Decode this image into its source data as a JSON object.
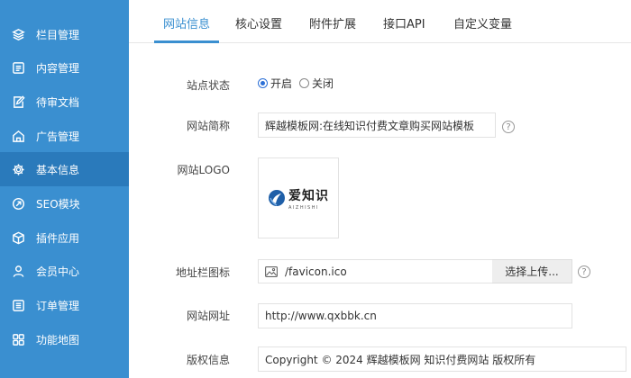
{
  "sidebar": {
    "items": [
      {
        "label": "栏目管理",
        "icon": "layers-icon"
      },
      {
        "label": "内容管理",
        "icon": "list-box-icon"
      },
      {
        "label": "待审文档",
        "icon": "edit-doc-icon"
      },
      {
        "label": "广告管理",
        "icon": "house-icon"
      },
      {
        "label": "基本信息",
        "icon": "gear-icon"
      },
      {
        "label": "SEO模块",
        "icon": "link-circle-icon"
      },
      {
        "label": "插件应用",
        "icon": "cube-icon"
      },
      {
        "label": "会员中心",
        "icon": "user-icon"
      },
      {
        "label": "订单管理",
        "icon": "order-list-icon"
      },
      {
        "label": "功能地图",
        "icon": "grid-icon"
      }
    ],
    "active_index": 4
  },
  "tabs": [
    {
      "label": "网站信息"
    },
    {
      "label": "核心设置"
    },
    {
      "label": "附件扩展"
    },
    {
      "label": "接口API"
    },
    {
      "label": "自定义变量"
    }
  ],
  "form": {
    "status": {
      "label": "站点状态",
      "options": [
        "开启",
        "关闭"
      ],
      "selected": "开启"
    },
    "short_name": {
      "label": "网站简称",
      "value": "辉越模板网:在线知识付费文章购买网站模板"
    },
    "logo": {
      "label": "网站LOGO",
      "logo_cn": "爱知识",
      "logo_en": "AIZHISHI"
    },
    "favicon": {
      "label": "地址栏图标",
      "value": "/favicon.ico",
      "button": "选择上传..."
    },
    "url": {
      "label": "网站网址",
      "value": "http://www.qxbbk.cn"
    },
    "copyright": {
      "label": "版权信息",
      "value": "Copyright © 2024 辉越模板网 知识付费网站 版权所有"
    }
  },
  "help_glyph": "?",
  "colors": {
    "sidebar": "#3a8fd0",
    "sidebar_active": "#2a7abb",
    "accent": "#3a8fd0",
    "radio": "#2b6fd6"
  }
}
